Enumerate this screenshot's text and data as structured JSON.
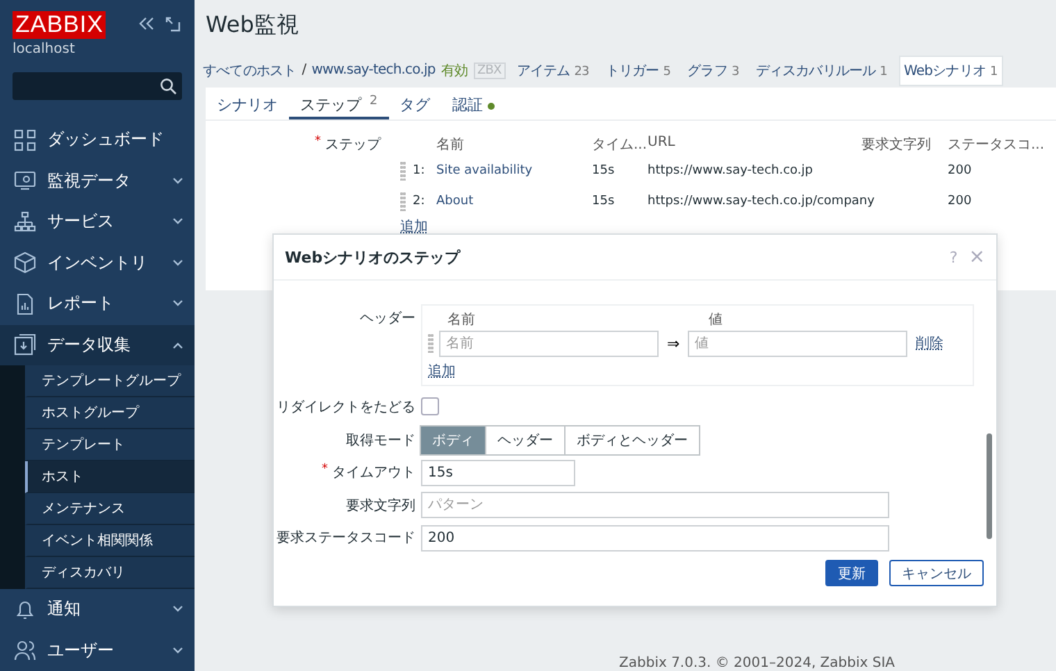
{
  "sidebar": {
    "logo": "ZABBIX",
    "host": "localhost",
    "items": [
      {
        "label": "ダッシュボード",
        "kind": "link"
      },
      {
        "label": "監視データ",
        "kind": "menu",
        "expanded": false
      },
      {
        "label": "サービス",
        "kind": "menu",
        "expanded": false
      },
      {
        "label": "インベントリ",
        "kind": "menu",
        "expanded": false
      },
      {
        "label": "レポート",
        "kind": "menu",
        "expanded": false
      },
      {
        "label": "データ収集",
        "kind": "menu",
        "expanded": true,
        "children": [
          {
            "label": "テンプレートグループ",
            "selected": false
          },
          {
            "label": "ホストグループ",
            "selected": false
          },
          {
            "label": "テンプレート",
            "selected": false
          },
          {
            "label": "ホスト",
            "selected": true
          },
          {
            "label": "メンテナンス",
            "selected": false
          },
          {
            "label": "イベント相関関係",
            "selected": false
          },
          {
            "label": "ディスカバリ",
            "selected": false
          }
        ]
      },
      {
        "label": "通知",
        "kind": "menu",
        "expanded": false
      },
      {
        "label": "ユーザー",
        "kind": "menu",
        "expanded": false
      }
    ]
  },
  "page": {
    "title": "Web監視",
    "breadcrumb": {
      "items": [
        "すべてのホスト",
        "www.say-tech.co.jp"
      ],
      "separator": "/"
    },
    "status": "有効",
    "badge": "ZBX",
    "host_tabs": [
      {
        "label": "アイテム",
        "count": "23",
        "selected": false
      },
      {
        "label": "トリガー",
        "count": "5",
        "selected": false
      },
      {
        "label": "グラフ",
        "count": "3",
        "selected": false
      },
      {
        "label": "ディスカバリルール",
        "count": "1",
        "selected": false
      },
      {
        "label": "Webシナリオ",
        "count": "1",
        "selected": true
      }
    ],
    "tabs": [
      {
        "label": "シナリオ",
        "selected": false
      },
      {
        "label": "ステップ",
        "count": "2",
        "selected": true
      },
      {
        "label": "タグ",
        "selected": false
      },
      {
        "label": "認証",
        "selected": false,
        "has_data": true
      }
    ],
    "steps": {
      "label": "ステップ",
      "required_mark": "*",
      "columns": [
        "名前",
        "タイム...",
        "URL",
        "要求文字列",
        "ステータスコ..."
      ],
      "rows": [
        {
          "number": "1:",
          "name": "Site availability",
          "timeout": "15s",
          "url": "https://www.say-tech.co.jp",
          "status_code": "200"
        },
        {
          "number": "2:",
          "name": "About",
          "timeout": "15s",
          "url": "https://www.say-tech.co.jp/company",
          "status_code": "200"
        }
      ],
      "add": "追加"
    },
    "footer": "Zabbix 7.0.3. © 2001–2024, Zabbix SIA"
  },
  "modal": {
    "title": "Webシナリオのステップ",
    "help": "?",
    "close": "×",
    "headers": {
      "label": "ヘッダー",
      "columns": [
        "名前",
        "値"
      ],
      "rows": [
        {
          "name_placeholder": "名前",
          "value_placeholder": "値",
          "arrow": "⇒",
          "remove": "削除"
        }
      ],
      "add": "追加"
    },
    "redirect": {
      "label": "リダイレクトをたどる",
      "checked": false
    },
    "mode": {
      "label": "取得モード",
      "options": [
        {
          "label": "ボディ",
          "selected": true
        },
        {
          "label": "ヘッダー",
          "selected": false
        },
        {
          "label": "ボディとヘッダー",
          "selected": false
        }
      ]
    },
    "timeout": {
      "label": "タイムアウト",
      "required_mark": "*",
      "value": "15s"
    },
    "required_string": {
      "label": "要求文字列",
      "placeholder": "パターン"
    },
    "status_code": {
      "label": "要求ステータスコード",
      "value": "200"
    },
    "buttons": [
      {
        "label": "更新",
        "kind": "primary"
      },
      {
        "label": "キャンセル",
        "kind": "secondary"
      }
    ]
  }
}
